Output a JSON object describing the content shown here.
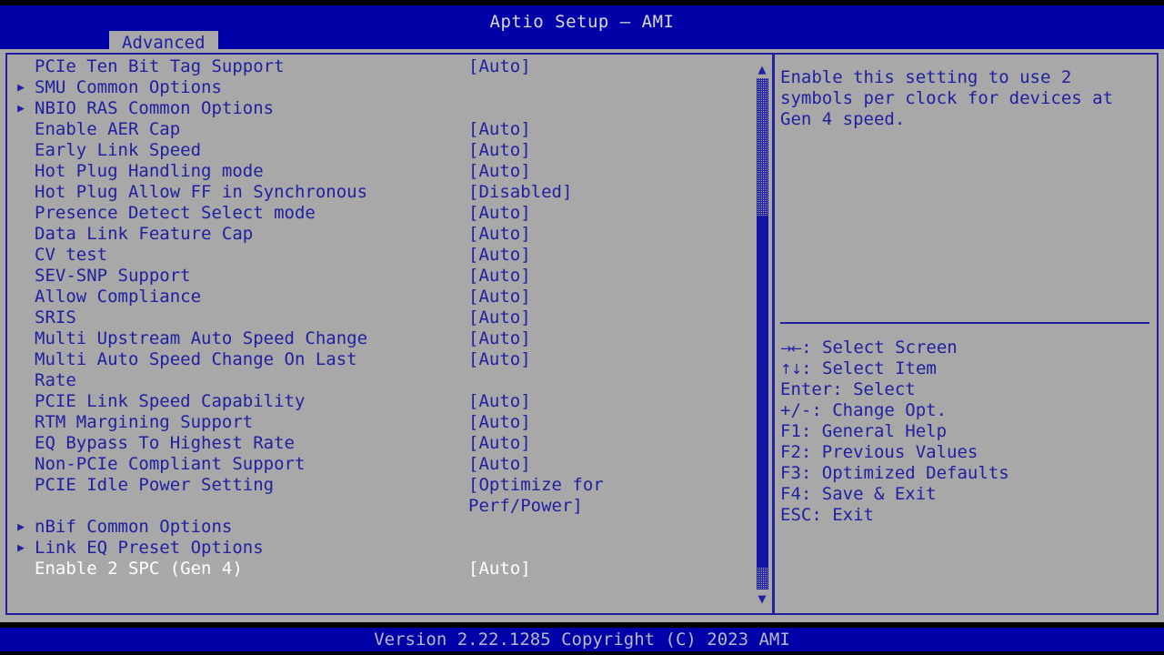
{
  "app": {
    "title": "Aptio Setup – AMI"
  },
  "tabs": [
    {
      "label": "Advanced",
      "active": true
    }
  ],
  "settings": {
    "rows": [
      {
        "arrow": "",
        "label": "PCIe Ten Bit Tag Support",
        "value": "[Auto]",
        "selected": false
      },
      {
        "arrow": "▶",
        "label": "SMU Common Options",
        "value": "",
        "selected": false
      },
      {
        "arrow": "▶",
        "label": "NBIO RAS Common Options",
        "value": "",
        "selected": false
      },
      {
        "arrow": "",
        "label": "Enable AER Cap",
        "value": "[Auto]",
        "selected": false
      },
      {
        "arrow": "",
        "label": "Early Link Speed",
        "value": "[Auto]",
        "selected": false
      },
      {
        "arrow": "",
        "label": "Hot Plug Handling mode",
        "value": "[Auto]",
        "selected": false
      },
      {
        "arrow": "",
        "label": "Hot Plug Allow FF in Synchronous",
        "value": "[Disabled]",
        "selected": false
      },
      {
        "arrow": "",
        "label": "Presence Detect Select mode",
        "value": "[Auto]",
        "selected": false
      },
      {
        "arrow": "",
        "label": "Data Link Feature Cap",
        "value": "[Auto]",
        "selected": false
      },
      {
        "arrow": "",
        "label": "CV test",
        "value": "[Auto]",
        "selected": false
      },
      {
        "arrow": "",
        "label": "SEV-SNP Support",
        "value": "[Auto]",
        "selected": false
      },
      {
        "arrow": "",
        "label": "Allow Compliance",
        "value": "[Auto]",
        "selected": false
      },
      {
        "arrow": "",
        "label": "SRIS",
        "value": "[Auto]",
        "selected": false
      },
      {
        "arrow": "",
        "label": "Multi Upstream Auto Speed Change",
        "value": "[Auto]",
        "selected": false
      },
      {
        "arrow": "",
        "label": "Multi Auto Speed Change On Last",
        "value": "[Auto]",
        "selected": false
      },
      {
        "arrow": "",
        "label": "Rate",
        "value": "",
        "selected": false
      },
      {
        "arrow": "",
        "label": "PCIE Link Speed Capability",
        "value": "[Auto]",
        "selected": false
      },
      {
        "arrow": "",
        "label": "RTM Margining Support",
        "value": "[Auto]",
        "selected": false
      },
      {
        "arrow": "",
        "label": "EQ Bypass To Highest Rate",
        "value": "[Auto]",
        "selected": false
      },
      {
        "arrow": "",
        "label": "Non-PCIe Compliant Support",
        "value": "[Auto]",
        "selected": false
      },
      {
        "arrow": "",
        "label": "PCIE Idle Power Setting",
        "value": "[Optimize for",
        "selected": false
      },
      {
        "arrow": "",
        "label": "",
        "value": "Perf/Power]",
        "selected": false
      },
      {
        "arrow": "▶",
        "label": "nBif Common Options",
        "value": "",
        "selected": false
      },
      {
        "arrow": "▶",
        "label": "Link EQ Preset Options",
        "value": "",
        "selected": false
      },
      {
        "arrow": "",
        "label": "Enable 2 SPC (Gen 4)",
        "value": "[Auto]",
        "selected": true
      }
    ]
  },
  "scrollbar": {
    "up_arrow": "▲",
    "down_arrow": "▼"
  },
  "help": {
    "text": "Enable this setting to use 2 symbols per clock for devices at Gen 4 speed.",
    "keys": [
      {
        "glyph": "→←",
        "text": ": Select Screen"
      },
      {
        "glyph": "↑↓",
        "text": ": Select Item"
      },
      {
        "glyph": "",
        "text": "Enter: Select"
      },
      {
        "glyph": "",
        "text": "+/-: Change Opt."
      },
      {
        "glyph": "",
        "text": "F1: General Help"
      },
      {
        "glyph": "",
        "text": "F2: Previous Values"
      },
      {
        "glyph": "",
        "text": "F3: Optimized Defaults"
      },
      {
        "glyph": "",
        "text": "F4: Save & Exit"
      },
      {
        "glyph": "",
        "text": "ESC: Exit"
      }
    ]
  },
  "footer": {
    "version": "Version 2.22.1285 Copyright (C) 2023 AMI"
  },
  "colors": {
    "bar_blue": "#0000a8",
    "panel_grey": "#a8a8a8",
    "text_blue": "#2020a0",
    "text_selected": "#ffffff",
    "title_text": "#d8d8d8"
  }
}
